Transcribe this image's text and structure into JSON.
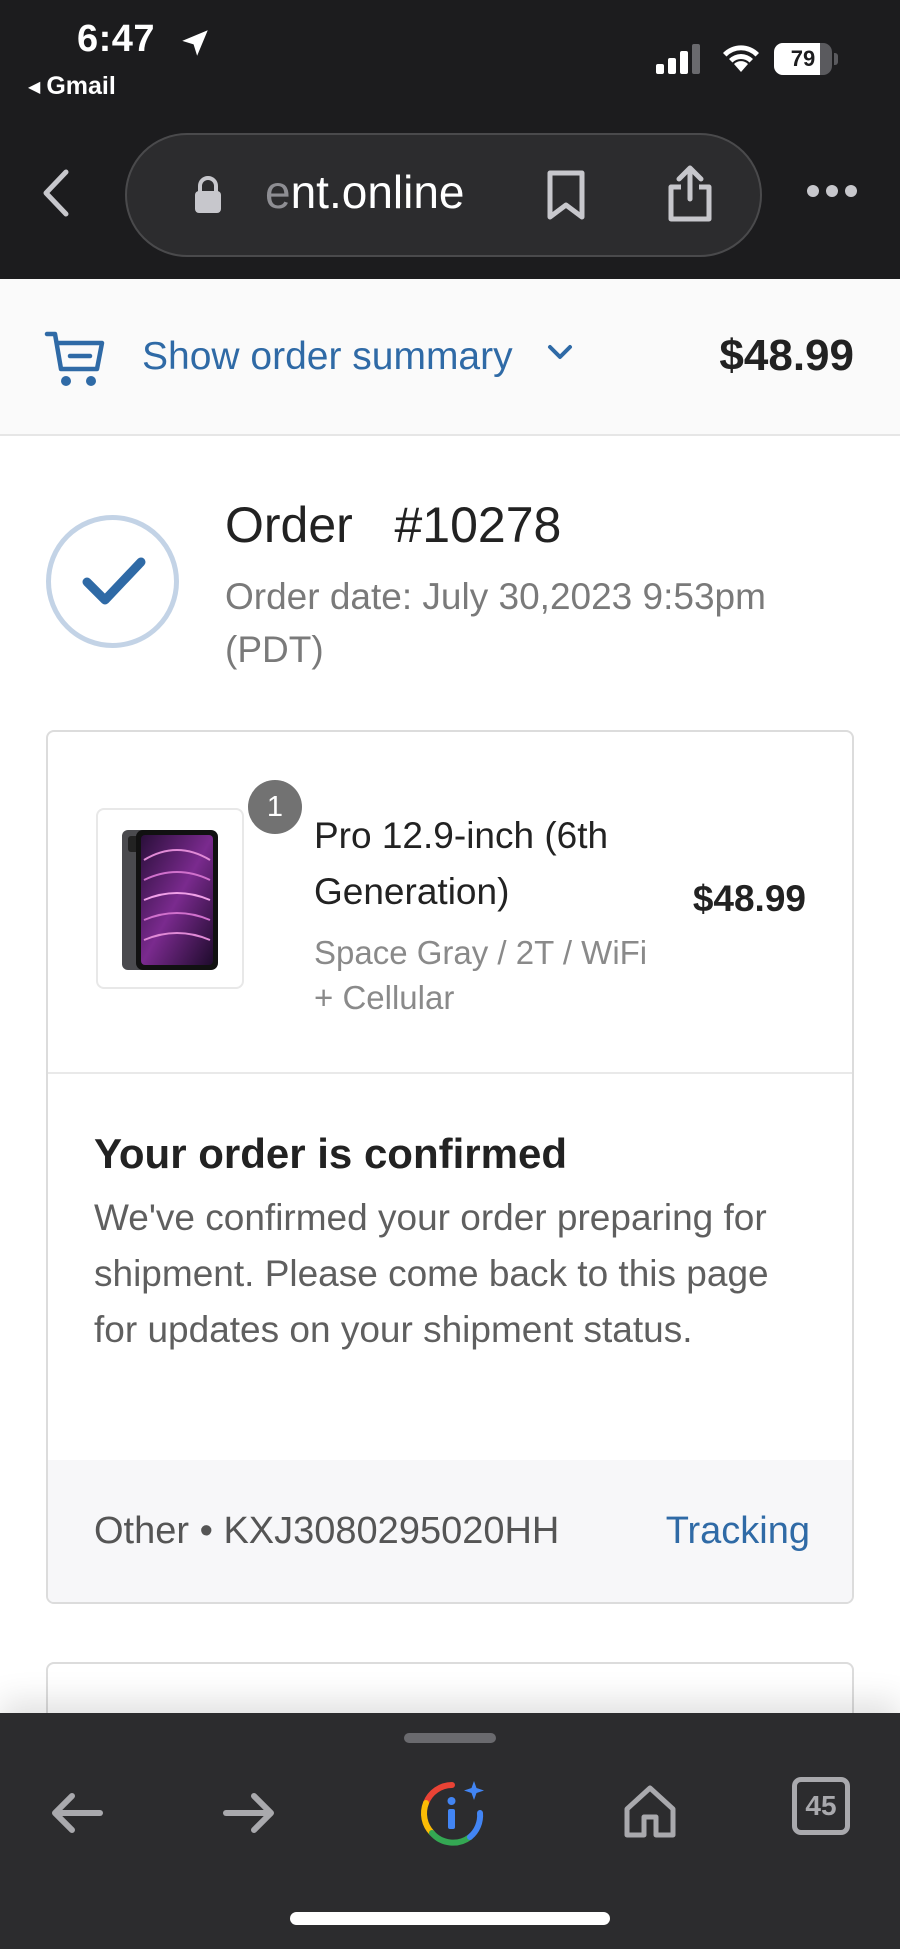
{
  "status_bar": {
    "time": "6:47",
    "back_app": "Gmail",
    "battery_percent": "79",
    "battery_level": 0.79
  },
  "browser": {
    "url_fade": "e",
    "url_text": "nt.online"
  },
  "summary": {
    "link_label": "Show order summary",
    "total": "$48.99",
    "accent_color": "#2f6aa6"
  },
  "order": {
    "title": "Order   #10278",
    "date": "Order date:  July 30,2023 9:53pm (PDT)"
  },
  "product": {
    "quantity": "1",
    "name": "Pro 12.9-inch (6th Generation)",
    "variant": "Space Gray / 2T / WiFi + Cellular",
    "price": "$48.99"
  },
  "confirmation": {
    "title": "Your order is confirmed",
    "body": "We've confirmed your order preparing for shipment. Please come back to this page for updates on your shipment status."
  },
  "tracking": {
    "info": "Other • KXJ3080295020HH",
    "link_label": "Tracking"
  },
  "toolbar": {
    "tab_count": "45",
    "icons": [
      "back-arrow-icon",
      "forward-arrow-icon",
      "google-lens-icon",
      "home-icon",
      "tabs-icon"
    ]
  }
}
